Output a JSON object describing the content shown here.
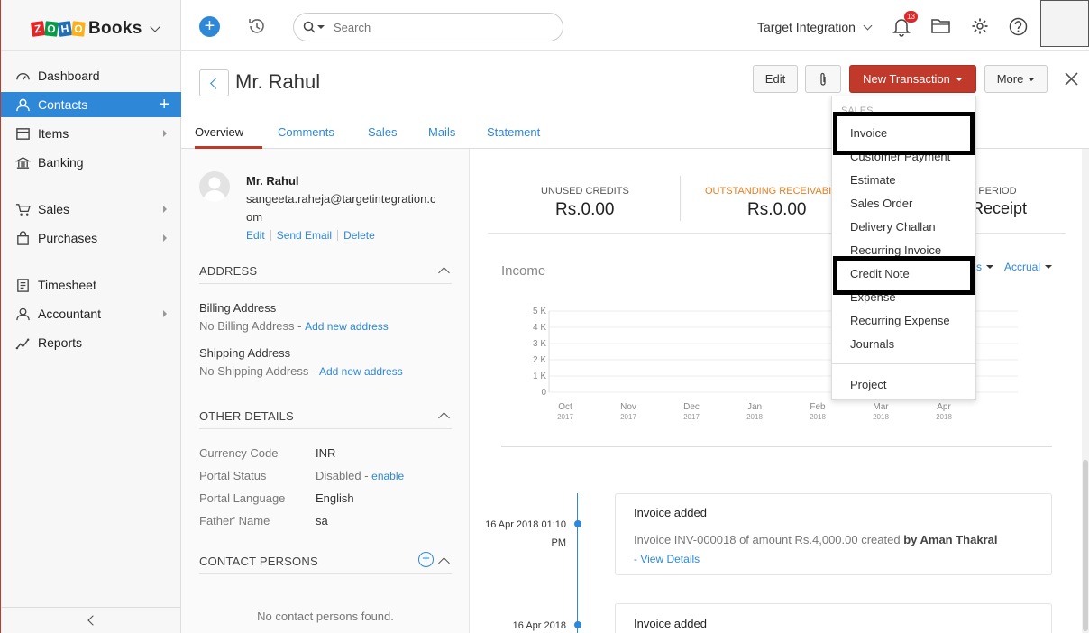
{
  "app": {
    "logo_letters": [
      "Z",
      "O",
      "H",
      "O"
    ],
    "logo_colors": [
      "#e42527",
      "#089949",
      "#226db4",
      "#f9b21d"
    ],
    "product": "Books",
    "accent": "#2f87d8",
    "brand_red": "#c0392b"
  },
  "sidebar": {
    "items": [
      {
        "label": "Dashboard",
        "icon": "dashboard-icon"
      },
      {
        "label": "Contacts",
        "icon": "contacts-icon",
        "active": true
      },
      {
        "label": "Items",
        "icon": "items-icon"
      },
      {
        "label": "Banking",
        "icon": "bank-icon"
      },
      {
        "label": "Sales",
        "icon": "cart-icon"
      },
      {
        "label": "Purchases",
        "icon": "bag-icon"
      },
      {
        "label": "Timesheet",
        "icon": "timesheet-icon"
      },
      {
        "label": "Accountant",
        "icon": "accountant-icon"
      },
      {
        "label": "Reports",
        "icon": "reports-icon"
      }
    ]
  },
  "topbar": {
    "search_placeholder": "Search",
    "org": "Target Integration",
    "notif_count": "13"
  },
  "contact": {
    "name": "Mr. Rahul",
    "email_line1": "sangeeta.raheja@targetintegration.c",
    "email_line2": "om"
  },
  "header": {
    "edit": "Edit",
    "new_transaction": "New Transaction",
    "more": "More"
  },
  "tabs": [
    "Overview",
    "Comments",
    "Sales",
    "Mails",
    "Statement"
  ],
  "profile_actions": {
    "edit": "Edit",
    "send_email": "Send Email",
    "delete": "Delete"
  },
  "address": {
    "title": "ADDRESS",
    "billing_label": "Billing Address",
    "billing_value": "No Billing Address",
    "billing_link": "Add new address",
    "shipping_label": "Shipping Address",
    "shipping_value": "No Shipping Address",
    "shipping_link": "Add new address"
  },
  "other_details": {
    "title": "OTHER DETAILS",
    "rows": [
      {
        "label": "Currency Code",
        "value": "INR"
      },
      {
        "label": "Portal Status",
        "value": "Disabled",
        "link": "enable"
      },
      {
        "label": "Portal Language",
        "value": "English"
      },
      {
        "label": "Father' Name",
        "value": "sa"
      }
    ]
  },
  "contact_persons": {
    "title": "CONTACT PERSONS",
    "empty": "No contact persons found."
  },
  "summary": {
    "unused_label": "UNUSED CREDITS",
    "unused_value": "Rs.0.00",
    "outstanding_label": "OUTSTANDING RECEIVABI",
    "outstanding_value": "Rs.0.00",
    "period_label": "UE PERIOD",
    "period_value": "Receipt"
  },
  "income": {
    "title": "Income",
    "filter1": "s",
    "filter2": "Accrual"
  },
  "chart_data": {
    "type": "bar",
    "title": "Income",
    "categories": [
      "Oct 2017",
      "Nov 2017",
      "Dec 2017",
      "Jan 2018",
      "Feb 2018",
      "Mar 2018",
      "Apr 2018"
    ],
    "x_ticks": [
      {
        "m": "Oct",
        "y": "2017"
      },
      {
        "m": "Nov",
        "y": "2017"
      },
      {
        "m": "Dec",
        "y": "2017"
      },
      {
        "m": "Jan",
        "y": "2018"
      },
      {
        "m": "Feb",
        "y": "2018"
      },
      {
        "m": "Mar",
        "y": "2018"
      },
      {
        "m": "Apr",
        "y": "2018"
      }
    ],
    "values": [
      0,
      0,
      0,
      0,
      0,
      0,
      0
    ],
    "y_ticks": [
      "0",
      "1 K",
      "2 K",
      "3 K",
      "4 K",
      "5 K"
    ],
    "ylim": [
      0,
      5000
    ],
    "grid": true
  },
  "dropdown": {
    "section": "SALES",
    "items": [
      "Invoice",
      "Customer Payment",
      "Estimate",
      "Sales Order",
      "Delivery Challan",
      "Recurring Invoice",
      "Credit Note",
      "Expense",
      "Recurring Expense",
      "Journals"
    ],
    "project": "Project"
  },
  "timeline": [
    {
      "date": "16 Apr 2018 01:10",
      "time": "PM",
      "title": "Invoice added",
      "desc_pre": "Invoice INV-000018 of amount Rs.4,000.00 created ",
      "desc_by": "by Aman Thakral",
      "link": "View Details"
    },
    {
      "date": "16 Apr 2018",
      "title": "Invoice added"
    }
  ]
}
